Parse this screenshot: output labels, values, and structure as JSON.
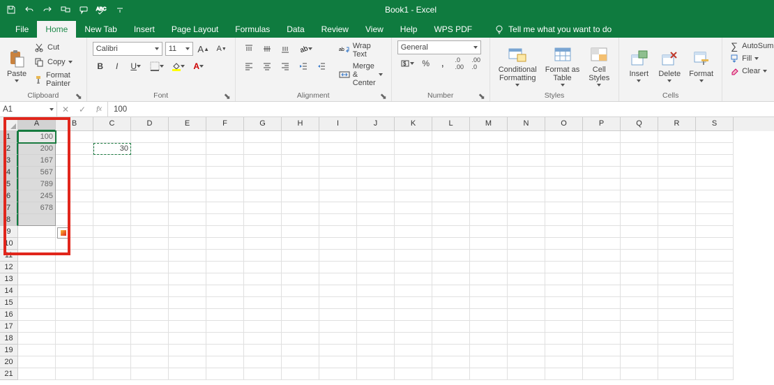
{
  "title": "Book1 - Excel",
  "tabs": [
    "File",
    "Home",
    "New Tab",
    "Insert",
    "Page Layout",
    "Formulas",
    "Data",
    "Review",
    "View",
    "Help",
    "WPS PDF"
  ],
  "active_tab": "Home",
  "tell_me": "Tell me what you want to do",
  "clipboard": {
    "paste": "Paste",
    "cut": "Cut",
    "copy": "Copy",
    "fp": "Format Painter",
    "label": "Clipboard"
  },
  "font": {
    "name": "Calibri",
    "size": "11",
    "label": "Font"
  },
  "alignment": {
    "wrap": "Wrap Text",
    "merge": "Merge & Center",
    "label": "Alignment"
  },
  "number": {
    "fmt": "General",
    "label": "Number"
  },
  "styles": {
    "cf": "Conditional\nFormatting",
    "fat": "Format as\nTable",
    "cs": "Cell\nStyles",
    "label": "Styles"
  },
  "cells": {
    "ins": "Insert",
    "del": "Delete",
    "fmt": "Format",
    "label": "Cells"
  },
  "editing": {
    "as": "AutoSum",
    "fill": "Fill",
    "clr": "Clear"
  },
  "namebox": "A1",
  "formula": "100",
  "columns": [
    "A",
    "B",
    "C",
    "D",
    "E",
    "F",
    "G",
    "H",
    "I",
    "J",
    "K",
    "L",
    "M",
    "N",
    "O",
    "P",
    "Q",
    "R",
    "S"
  ],
  "rows": 21,
  "a_values": [
    "100",
    "200",
    "167",
    "567",
    "789",
    "245",
    "678"
  ],
  "c2": "30",
  "chart_data": {
    "type": "table",
    "note": "Column A rows 1–7 selected; C2 contains 30 with marching-ants copy border",
    "columns": [
      "A"
    ],
    "values": [
      100,
      200,
      167,
      567,
      789,
      245,
      678
    ],
    "c2": 30
  }
}
